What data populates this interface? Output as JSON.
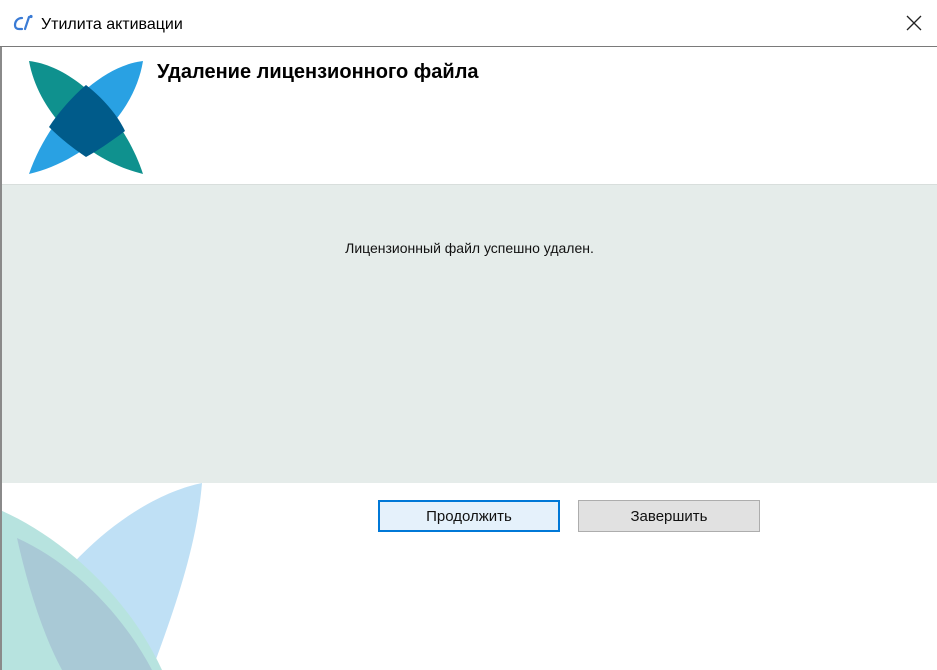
{
  "window": {
    "title": "Утилита активации",
    "app_icon": "activation-utility-icon",
    "close_icon": "close-icon"
  },
  "header": {
    "title": "Удаление лицензионного файла",
    "logo": "company-logo"
  },
  "content": {
    "message": "Лицензионный файл успешно удален."
  },
  "buttons": {
    "continue_label": "Продолжить",
    "finish_label": "Завершить"
  },
  "colors": {
    "content_bg": "#e5ecea",
    "accent": "#0078d7",
    "logo_blue": "#29a1e3",
    "logo_teal": "#0f918e",
    "logo_dark": "#005b8a"
  }
}
